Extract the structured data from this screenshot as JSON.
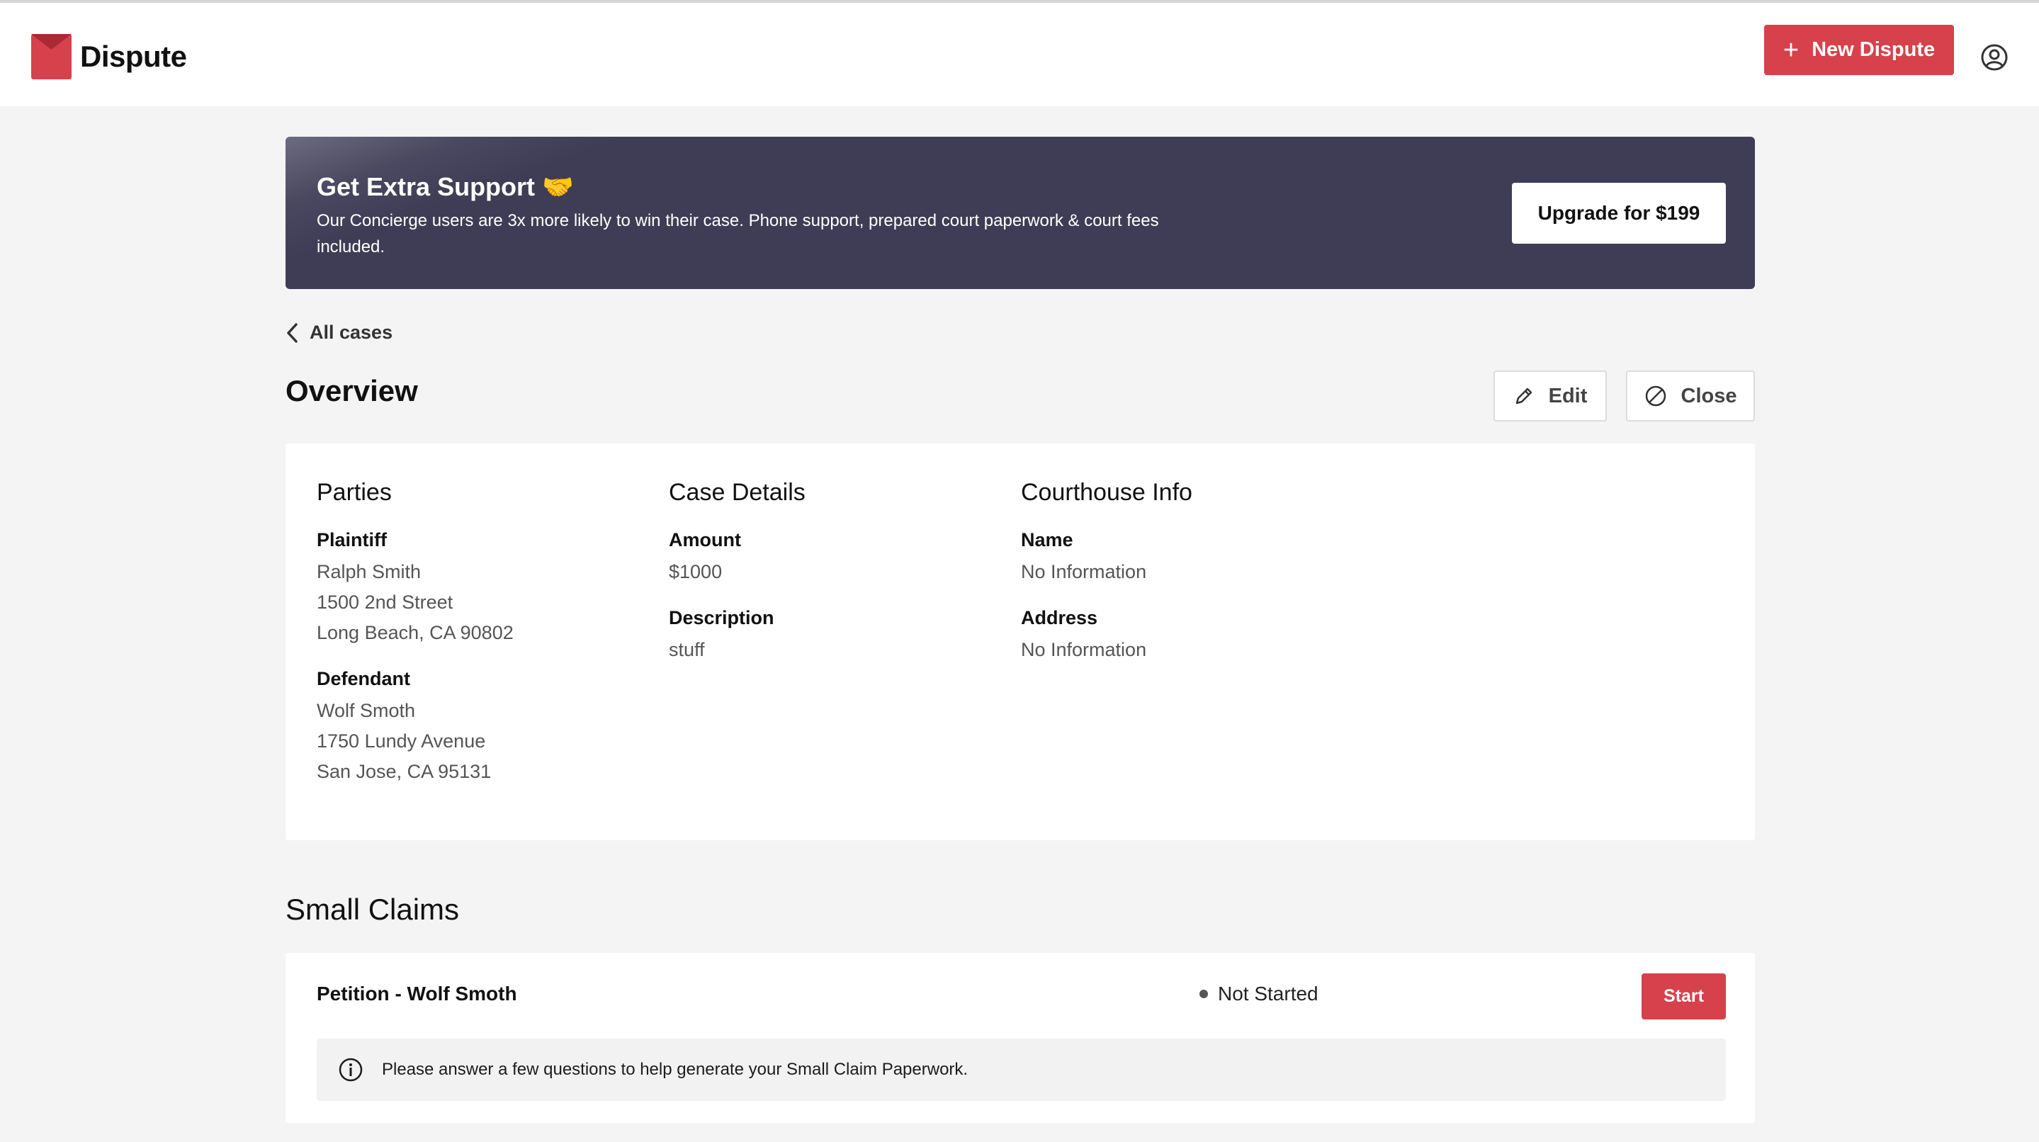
{
  "header": {
    "brand": "Dispute",
    "brand_color": "#d6414c",
    "new_button_label": "New Dispute",
    "user_icon": "user-circle-icon"
  },
  "banner": {
    "title": "Get Extra Support 🤝",
    "body": "Our Concierge users are 3x more likely to win their case. Phone support, prepared court paperwork & court fees included.",
    "button_label": "Upgrade for $199"
  },
  "nav": {
    "back_label": "All cases"
  },
  "overview": {
    "title": "Overview",
    "edit_label": "Edit",
    "close_label": "Close",
    "parties": {
      "heading": "Parties",
      "plaintiff_label": "Plaintiff",
      "plaintiff_name": "Ralph Smith",
      "plaintiff_street": "1500 2nd Street",
      "plaintiff_city": "Long Beach, CA 90802",
      "defendant_label": "Defendant",
      "defendant_name": "Wolf Smoth",
      "defendant_street": "1750 Lundy Avenue",
      "defendant_city": "San Jose, CA 95131"
    },
    "case_details": {
      "heading": "Case Details",
      "amount_label": "Amount",
      "amount_value": "$1000",
      "description_label": "Description",
      "description_value": "stuff"
    },
    "courthouse": {
      "heading": "Courthouse Info",
      "name_label": "Name",
      "name_value": "No Information",
      "address_label": "Address",
      "address_value": "No Information"
    }
  },
  "small_claims": {
    "title": "Small Claims",
    "items": [
      {
        "name": "Petition - Wolf Smoth",
        "status": "Not Started",
        "button_label": "Start",
        "notice": "Please answer a few questions to help generate your Small Claim Paperwork."
      }
    ]
  }
}
